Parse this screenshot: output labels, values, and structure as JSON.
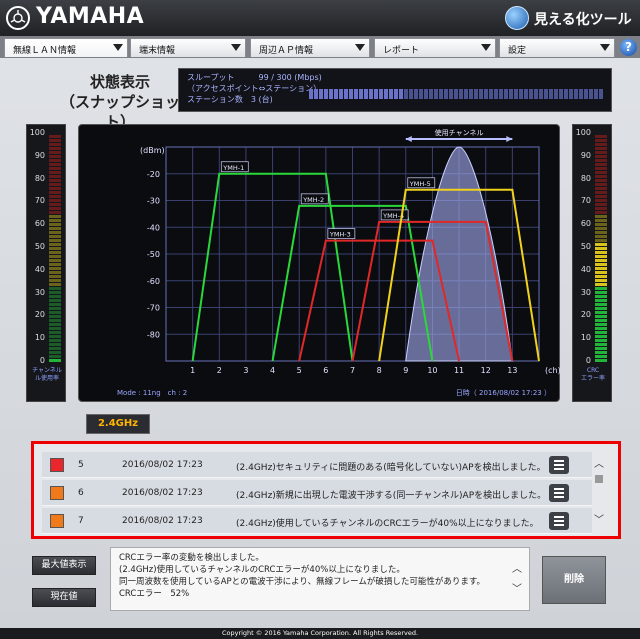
{
  "header": {
    "logo_text": "YAMAHA",
    "tool_name": "見える化ツール"
  },
  "tabs": [
    {
      "label": "無線ＬＡＮ情報"
    },
    {
      "label": "端末情報"
    },
    {
      "label": "周辺ＡＰ情報"
    },
    {
      "label": "レポート"
    },
    {
      "label": "設定"
    }
  ],
  "help_label": "?",
  "state_title_line1": "状態表示",
  "state_title_line2": "（スナップショット）",
  "summary": {
    "throughput_label": "スループット",
    "throughput_value": "99 / 300 (Mbps)",
    "throughput_sub": "（アクセスポイント⇔ステーション）",
    "stations_label": "ステーション数",
    "stations_value": "3 (台)",
    "throughput_fraction": 0.33
  },
  "left_meter": {
    "scale": [
      "100",
      "90",
      "80",
      "70",
      "60",
      "50",
      "40",
      "30",
      "20",
      "10",
      "0"
    ],
    "caption_line1": "チャンネル",
    "caption_line2": "ル使用率",
    "level": 0
  },
  "right_meter": {
    "scale": [
      "100",
      "90",
      "80",
      "70",
      "60",
      "50",
      "40",
      "30",
      "20",
      "10",
      "0"
    ],
    "caption_line1": "CRC",
    "caption_line2": "エラー率",
    "level": 52
  },
  "chart_data": {
    "type": "area",
    "xlabel": "(ch)",
    "ylabel": "(dBm)",
    "x_ticks": [
      "1",
      "2",
      "3",
      "4",
      "5",
      "6",
      "7",
      "8",
      "9",
      "10",
      "11",
      "12",
      "13"
    ],
    "y_ticks": [
      "-20",
      "-30",
      "-40",
      "-50",
      "-60",
      "-70",
      "-80"
    ],
    "xlim": [
      0,
      14
    ],
    "ylim": [
      -90,
      -10
    ],
    "annotation": "使用チャンネル",
    "annotation_range": [
      9,
      13
    ],
    "mode_text": "Mode : 11ng　ch : 2",
    "time_text": "日時（ 2016/08/02 17:23 ）",
    "used_channel": {
      "center": 11,
      "width": 4,
      "peak": -10
    },
    "series": [
      {
        "name": "YMH-1",
        "color": "#2bd83a",
        "center": 4,
        "level": -20
      },
      {
        "name": "YMH-2",
        "color": "#2bd83a",
        "center": 7,
        "level": -32
      },
      {
        "name": "YMH-3",
        "color": "#e02828",
        "center": 8,
        "level": -45
      },
      {
        "name": "YMH-4",
        "color": "#e02828",
        "center": 10,
        "level": -38
      },
      {
        "name": "YMH-5",
        "color": "#f0d21c",
        "center": 11,
        "level": -26
      }
    ]
  },
  "band_label": "2.4GHz",
  "events": [
    {
      "color": "#e8262c",
      "num": "5",
      "time": "2016/08/02 17:23",
      "msg": "(2.4GHz)セキュリティに問題のある(暗号化していない)APを検出しました。"
    },
    {
      "color": "#f07a1a",
      "num": "6",
      "time": "2016/08/02 17:23",
      "msg": "(2.4GHz)新規に出現した電波干渉する(同一チャンネル)APを検出しました。"
    },
    {
      "color": "#f07a1a",
      "num": "7",
      "time": "2016/08/02 17:23",
      "msg": "(2.4GHz)使用しているチャンネルのCRCエラーが40%以上になりました。"
    }
  ],
  "buttons": {
    "max": "最大値表示",
    "current": "現在値",
    "delete": "削除"
  },
  "detail_lines": [
    "CRCエラー率の変動を検出しました。",
    "(2.4GHz)使用しているチャンネルのCRCエラーが40%以上になりました。",
    "同一周波数を使用しているAPとの電波干渉により、無線フレームが破損した可能性があります。",
    "CRCエラー　52%"
  ],
  "footer": "Copyright © 2016 Yamaha Corporation. All Rights Reserved."
}
